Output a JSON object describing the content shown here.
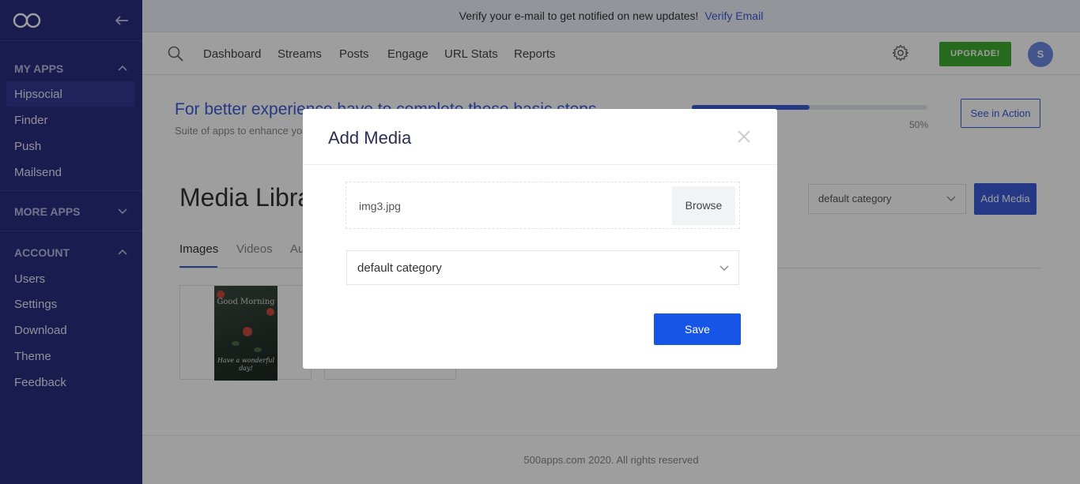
{
  "sidebar": {
    "my_apps_label": "MY APPS",
    "my_apps": [
      "Hipsocial",
      "Finder",
      "Push",
      "Mailsend"
    ],
    "more_apps_label": "MORE APPS",
    "account_label": "ACCOUNT",
    "account": [
      "Users",
      "Settings",
      "Download",
      "Theme",
      "Feedback"
    ]
  },
  "verify": {
    "text": "Verify your e-mail to get notified on new updates!",
    "link": "Verify Email"
  },
  "nav": {
    "items": [
      "Dashboard",
      "Streams",
      "Posts",
      "Engage",
      "URL Stats",
      "Reports"
    ],
    "upgrade": "UPGRADE!",
    "avatar_initial": "S"
  },
  "promo": {
    "title": "For better experience have to complete these basic steps",
    "subtitle": "Suite of apps to enhance you",
    "progress_fraction": 0.5,
    "progress_label": "50%",
    "see_action": "See in Action"
  },
  "media": {
    "title": "Media Library",
    "category_value": "default category",
    "add_button": "Add Media",
    "tabs": [
      "Images",
      "Videos",
      "Au"
    ],
    "thumb_text": "Good Morning",
    "thumb_script": "Have a wonderful day!"
  },
  "footer": {
    "text": "500apps.com 2020. All rights reserved"
  },
  "modal": {
    "title": "Add Media",
    "file_name": "img3.jpg",
    "browse": "Browse",
    "category": "default category",
    "save": "Save"
  },
  "colors": {
    "sidebar_bg": "#2a2e82",
    "accent": "#3a5bd9",
    "save": "#1755e6",
    "upgrade": "#3eab2f"
  }
}
